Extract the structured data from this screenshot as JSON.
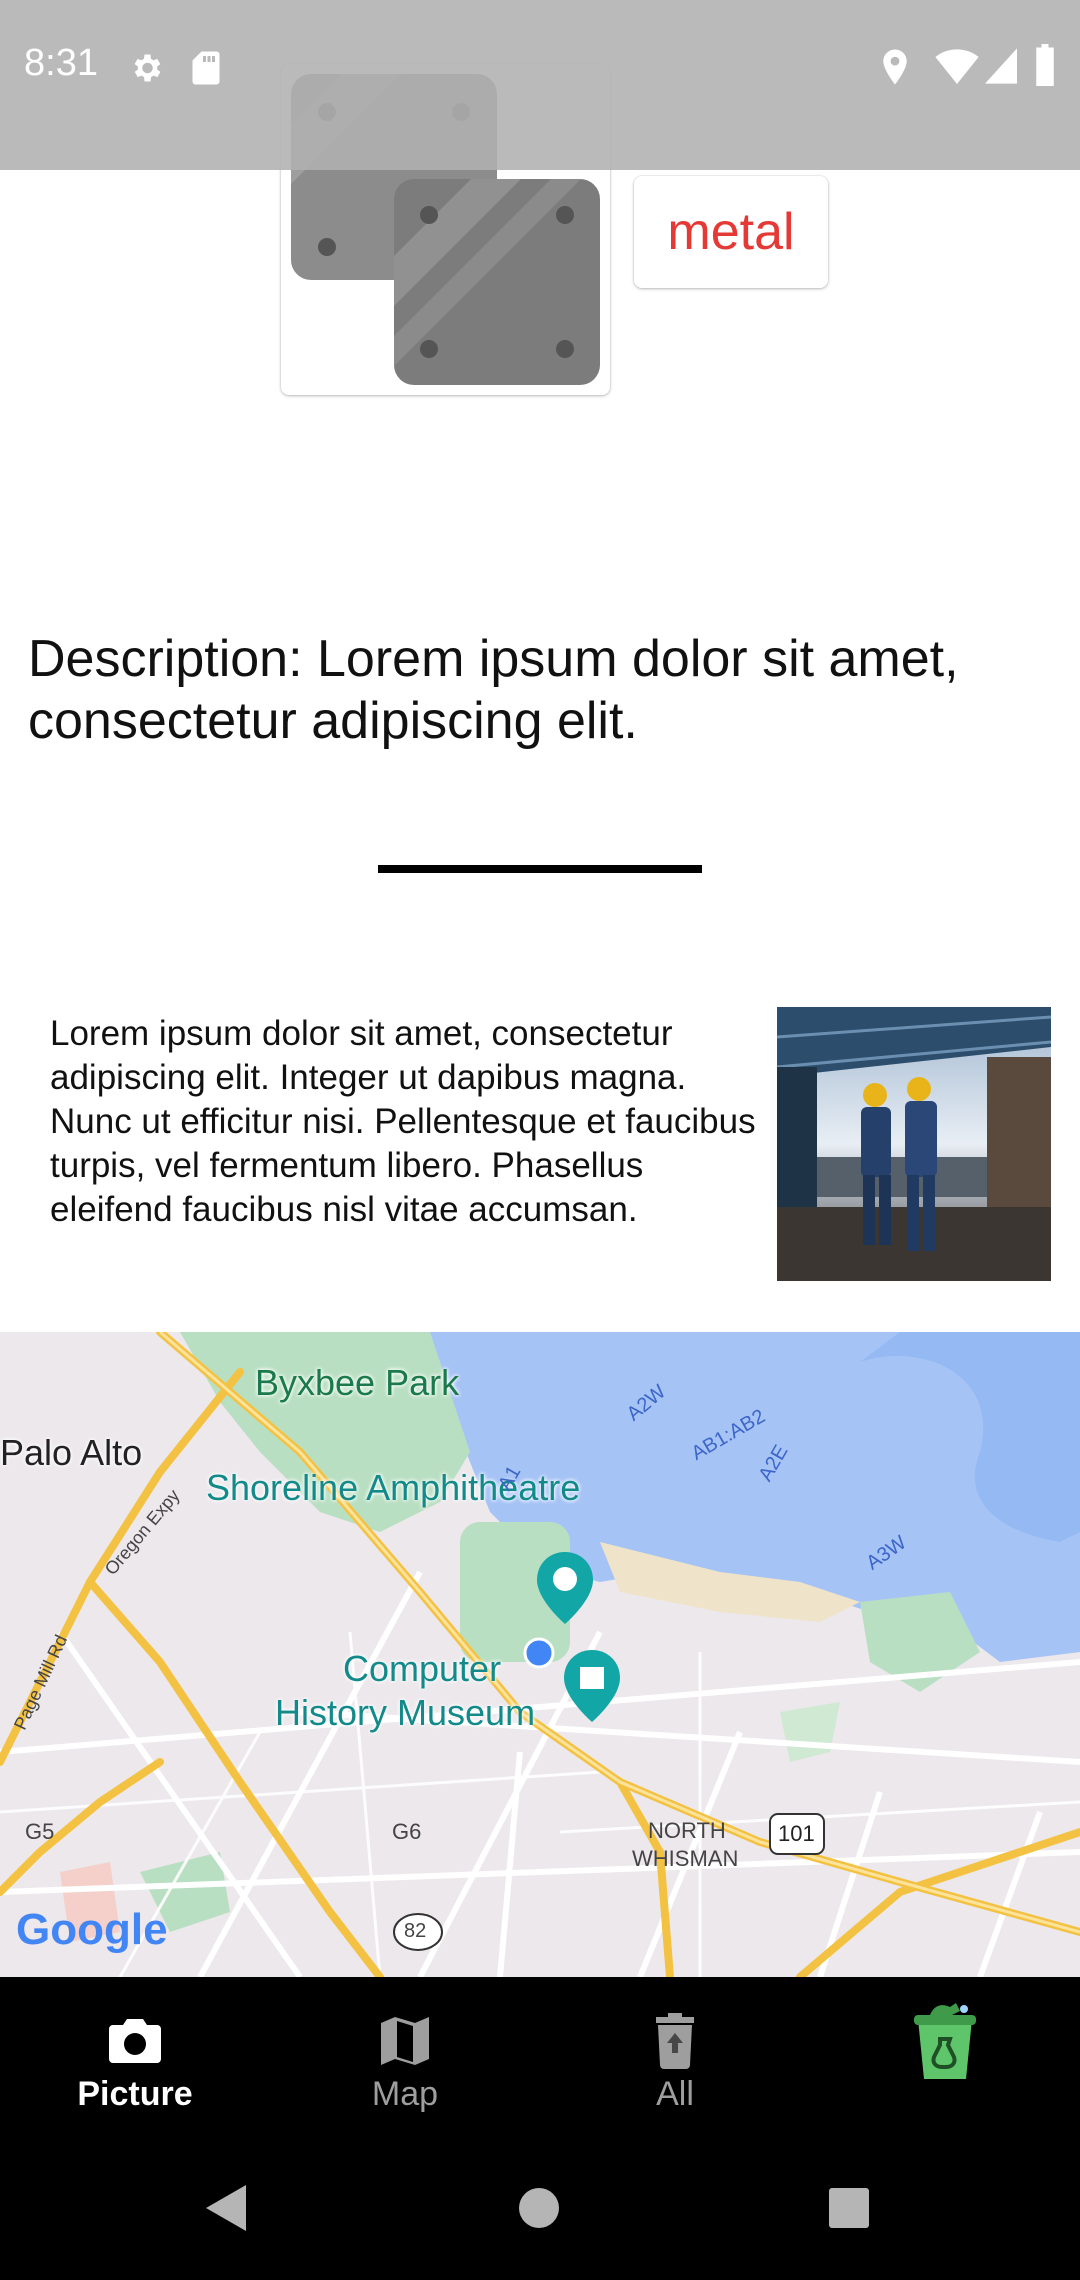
{
  "status_bar": {
    "time": "8:31",
    "left_icons": [
      "settings-icon",
      "sd-card-icon"
    ],
    "right_icons": [
      "location-icon",
      "wifi-icon",
      "signal-icon",
      "battery-icon"
    ]
  },
  "material": {
    "icon": "metal-plates-icon",
    "label": "metal",
    "label_color": "#e53935"
  },
  "description": "Description: Lorem ipsum dolor sit amet, consectetur adipiscing elit.",
  "article": {
    "text": "Lorem ipsum dolor sit amet, consectetur adipiscing elit. Integer ut dapibus magna. Nunc ut efficitur nisi. Pellentesque et faucibus turpis, vel fermentum libero. Phasellus eleifend faucibus nisl vitae accumsan.",
    "photo": "factory-workers-photo"
  },
  "map": {
    "labels": {
      "byxbee": "Byxbee Park",
      "palo_alto": "Palo Alto",
      "shoreline": "Shoreline Amphitheatre",
      "museum_line1": "Computer",
      "museum_line2": "History Museum",
      "north": "NORTH",
      "whisman": "WHISMAN",
      "oregon": "Oregon Expy",
      "page_mill": "Page Mill Rd",
      "g5": "G5",
      "g6": "G6",
      "r82": "82",
      "r101": "101",
      "a1": "A1",
      "a2w": "A2W",
      "ab1ab2": "AB1:AB2",
      "a2e": "A2E",
      "a3w": "A3W"
    },
    "attribution": "Google"
  },
  "bottom_nav": {
    "items": [
      {
        "label": "Picture",
        "icon": "camera-icon",
        "active": true
      },
      {
        "label": "Map",
        "icon": "map-icon",
        "active": false
      },
      {
        "label": "All",
        "icon": "trash-can-icon",
        "active": false
      },
      {
        "label": "",
        "icon": "recycling-bin-icon",
        "active": false
      }
    ]
  },
  "system_nav": [
    "back-icon",
    "home-icon",
    "recents-icon"
  ]
}
